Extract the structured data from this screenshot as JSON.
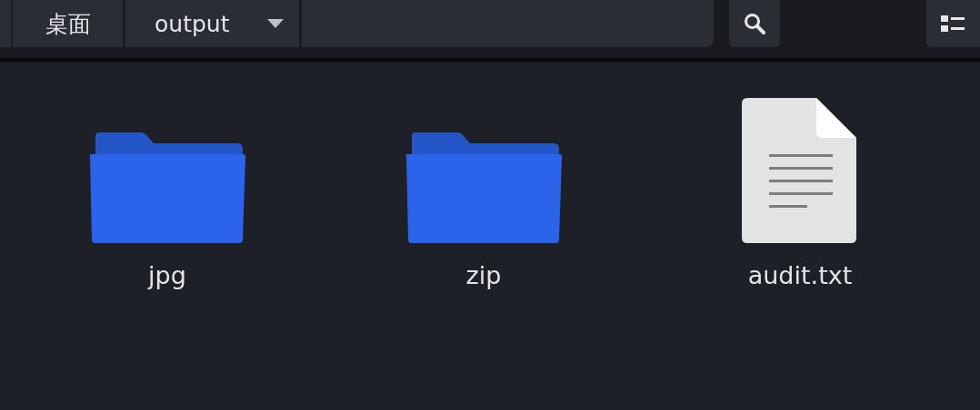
{
  "path_bar": {
    "segments": [
      {
        "label": "桌面",
        "dropdown": false
      },
      {
        "label": "output",
        "dropdown": true
      }
    ]
  },
  "files": [
    {
      "name": "jpg",
      "kind": "folder"
    },
    {
      "name": "zip",
      "kind": "folder"
    },
    {
      "name": "audit.txt",
      "kind": "text"
    }
  ]
}
